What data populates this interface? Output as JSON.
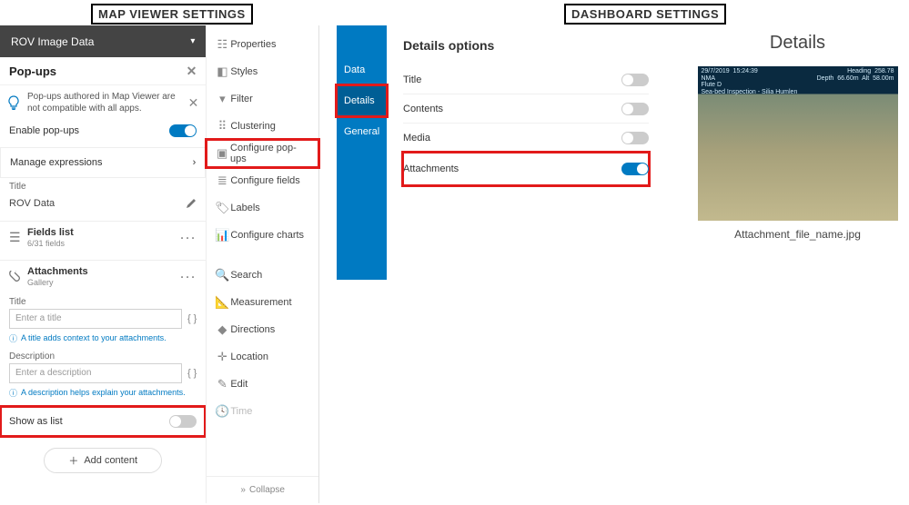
{
  "headers": {
    "left": "MAP VIEWER SETTINGS",
    "right": "DASHBOARD SETTINGS"
  },
  "mapviewer": {
    "layer_name": "ROV Image Data",
    "panel_title": "Pop-ups",
    "banner": "Pop-ups authored in Map Viewer are not compatible with all apps.",
    "enable_label": "Enable pop-ups",
    "manage_label": "Manage expressions",
    "section_title_label": "Title",
    "title_value": "ROV Data",
    "fields_card": {
      "name": "Fields list",
      "sub": "6/31 fields"
    },
    "attach_card": {
      "name": "Attachments",
      "sub": "Gallery"
    },
    "attach_title_label": "Title",
    "attach_title_placeholder": "Enter a title",
    "attach_title_hint": "A title adds context to your attachments.",
    "attach_desc_label": "Description",
    "attach_desc_placeholder": "Enter a description",
    "attach_desc_hint": "A description helps explain your attachments.",
    "show_as_list_label": "Show as list",
    "add_content_label": "Add content",
    "actions": {
      "properties": "Properties",
      "styles": "Styles",
      "filter": "Filter",
      "clustering": "Clustering",
      "configure_popups": "Configure pop-ups",
      "configure_fields": "Configure fields",
      "labels": "Labels",
      "configure_charts": "Configure charts",
      "search": "Search",
      "measurement": "Measurement",
      "directions": "Directions",
      "location": "Location",
      "edit": "Edit",
      "time": "Time",
      "collapse": "Collapse"
    }
  },
  "dashboard": {
    "tabs": {
      "data": "Data",
      "details": "Details",
      "general": "General"
    },
    "options_heading": "Details options",
    "options": {
      "title": "Title",
      "contents": "Contents",
      "media": "Media",
      "attachments": "Attachments"
    },
    "details_heading": "Details",
    "attachment_caption": "Attachment_file_name.jpg",
    "overlay": {
      "date": "29/7/2019",
      "time": "15:24:39",
      "vessel": "NMA",
      "mission": "Flute D",
      "task": "Sea-bed Inspection - Silia Humlen",
      "heading_lbl": "Heading",
      "heading_val": "258.78",
      "depth_lbl": "Depth",
      "depth_val": "66.60m",
      "alt_lbl": "Alt",
      "alt_val": "58.00m"
    }
  }
}
